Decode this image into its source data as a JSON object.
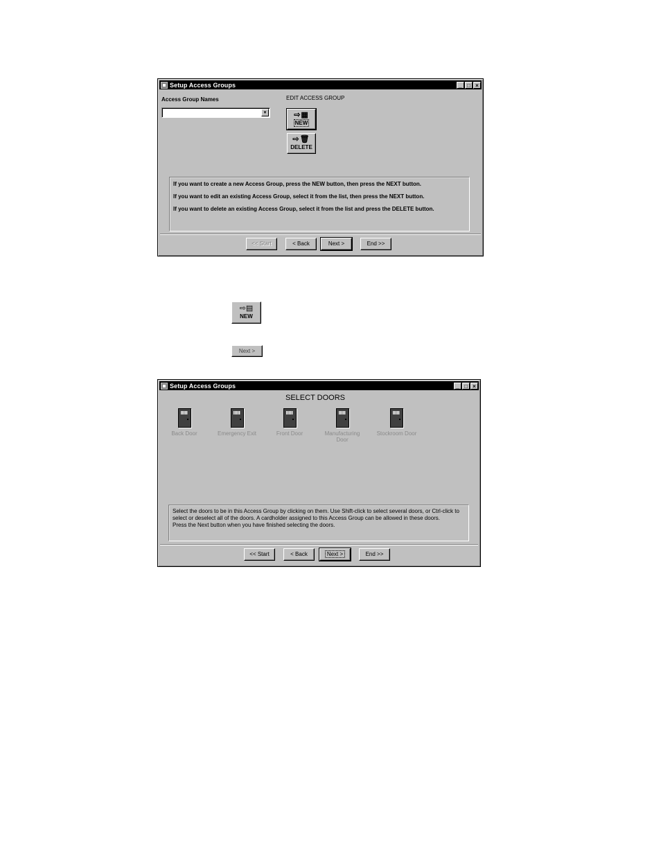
{
  "window1": {
    "title": "Setup Access Groups",
    "controls": {
      "minimize": "_",
      "maximize": "□",
      "close": "×"
    },
    "access_group_names_label": "Access Group Names",
    "access_group_combo": {
      "value": "",
      "arrow": "▼"
    },
    "edit_heading": "EDIT ACCESS GROUP",
    "new_button": {
      "icons": "⇨▦",
      "label": "NEW"
    },
    "delete_button": {
      "icons": "⇨🗑",
      "label": "DELETE"
    },
    "instructions": [
      "If you want to create a new Access Group, press the NEW button, then press the NEXT button.",
      "If you want to edit an existing Access Group, select it from the list, then press the NEXT button.",
      "If you want to delete an existing Access Group, select it from the list and press the DELETE button."
    ],
    "nav": {
      "start": "<< Start",
      "back": "< Back",
      "next": "Next >",
      "end": "End >>"
    }
  },
  "standalone": {
    "new_button": {
      "icons": "⇨▤",
      "label": "NEW"
    },
    "next_button": {
      "label": "Next >"
    }
  },
  "window2": {
    "title": "Setup Access Groups",
    "controls": {
      "minimize": "_",
      "maximize": "□",
      "close": "×"
    },
    "heading": "SELECT DOORS",
    "doors": [
      {
        "label": "Back Door"
      },
      {
        "label": "Emergency Exit"
      },
      {
        "label": "Front Door"
      },
      {
        "label": "Manufacturing Door"
      },
      {
        "label": "Stockroom Door"
      }
    ],
    "instructions": "Select the doors to be in this Access Group by clicking on them.  Use Shift-click to select several doors, or Ctrl-click to select or deselect all of the doors.  A cardholder assigned to this Access Group can be allowed in these doors.",
    "instructions2": "Press the Next button when you have finished selecting the doors.",
    "nav": {
      "start": "<< Start",
      "back": "< Back",
      "next": "Next >",
      "end": "End >>"
    }
  }
}
